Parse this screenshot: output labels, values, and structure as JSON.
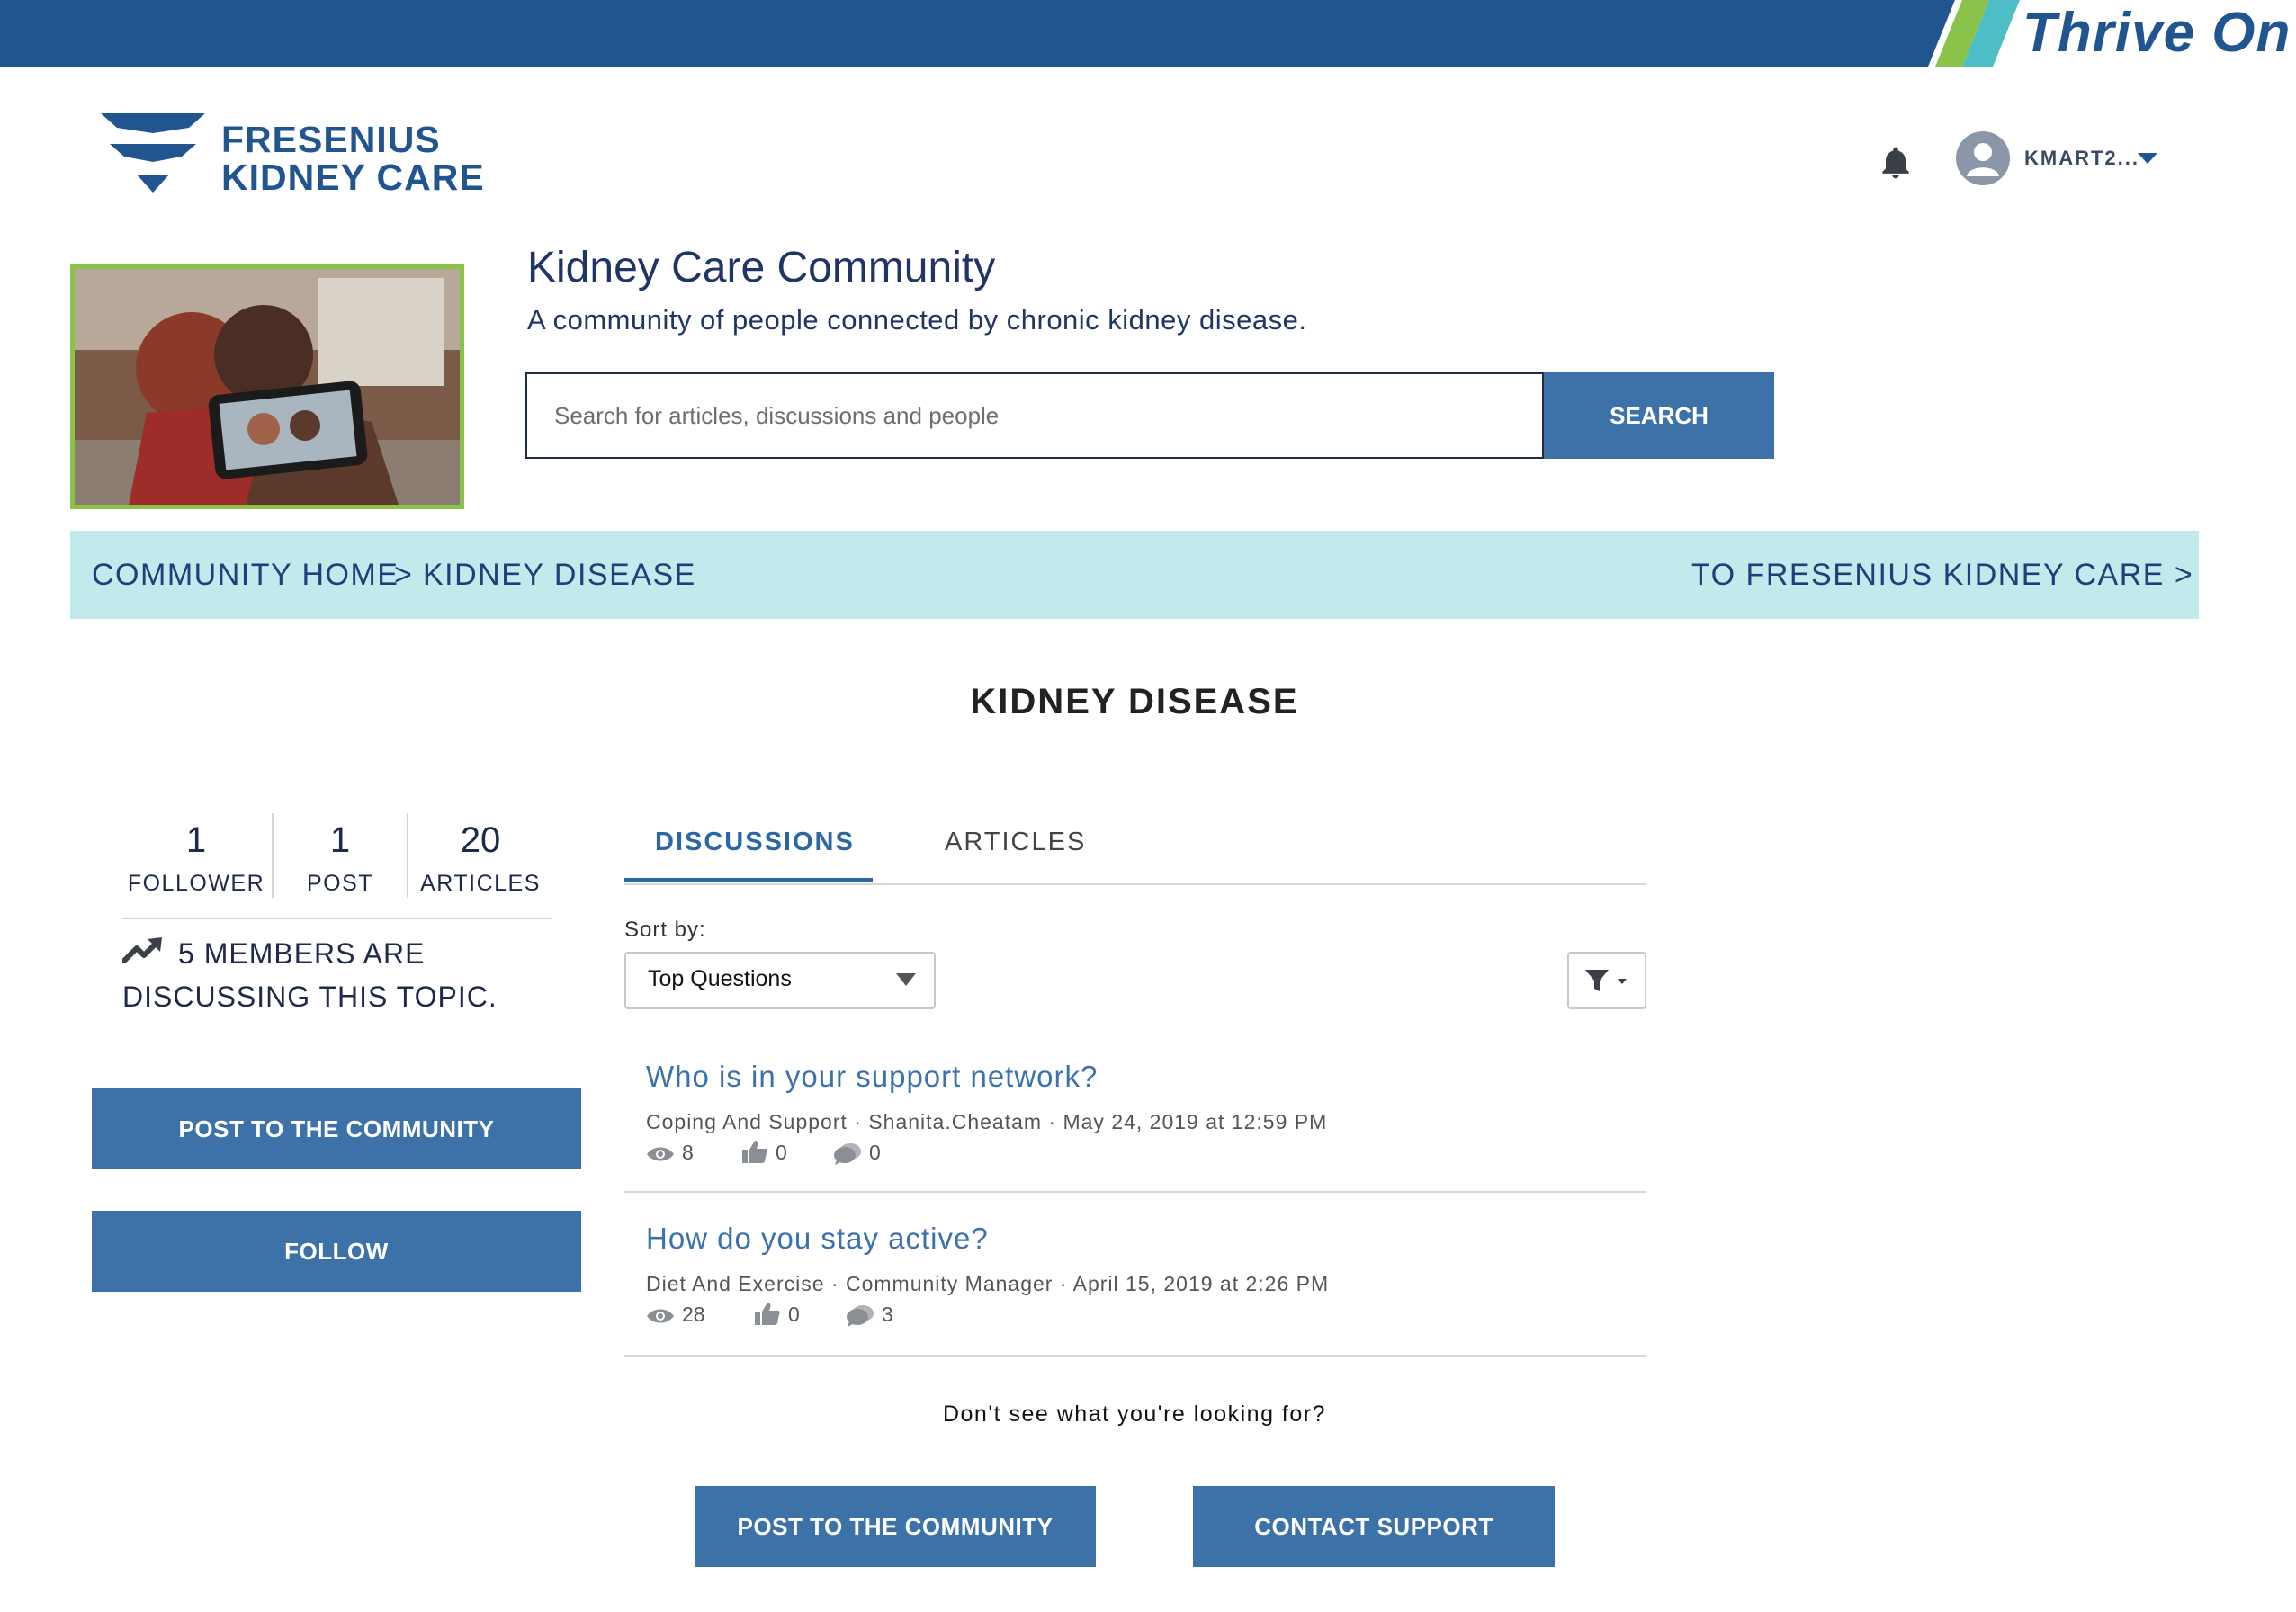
{
  "brand": {
    "tagline": "Thrive On",
    "name_line1": "FRESENIUS",
    "name_line2": "KIDNEY CARE"
  },
  "user": {
    "username": "KMART2..."
  },
  "hero": {
    "title": "Kidney Care Community",
    "subtitle": "A community of people connected by chronic kidney disease.",
    "search_placeholder": "Search for articles, discussions and people",
    "search_button": "SEARCH"
  },
  "breadcrumb": {
    "home": "COMMUNITY HOME",
    "separator": ">",
    "current": "KIDNEY DISEASE",
    "right_link": "TO FRESENIUS KIDNEY CARE >"
  },
  "topic": {
    "title": "KIDNEY DISEASE"
  },
  "stats": [
    {
      "value": "1",
      "label": "FOLLOWER"
    },
    {
      "value": "1",
      "label": "POST"
    },
    {
      "value": "20",
      "label": "ARTICLES"
    }
  ],
  "members_text": "5 MEMBERS ARE DISCUSSING THIS TOPIC.",
  "left_buttons": {
    "post": "POST TO THE COMMUNITY",
    "follow": "FOLLOW"
  },
  "tabs": [
    {
      "label": "DISCUSSIONS",
      "active": true
    },
    {
      "label": "ARTICLES",
      "active": false
    }
  ],
  "sort": {
    "label": "Sort by:",
    "value": "Top Questions"
  },
  "discussions": [
    {
      "title": "Who is in your support network?",
      "meta": "Coping And Support · Shanita.Cheatam · May 24, 2019 at 12:59 PM",
      "views": "8",
      "likes": "0",
      "replies": "0"
    },
    {
      "title": "How do you stay active?",
      "meta": "Diet And Exercise · Community Manager · April 15, 2019 at 2:26 PM",
      "views": "28",
      "likes": "0",
      "replies": "3"
    }
  ],
  "footer": {
    "help_text": "Don't see what you're looking for?",
    "post_button": "POST TO THE COMMUNITY",
    "contact_button": "CONTACT SUPPORT"
  },
  "colors": {
    "brand_blue": "#21558f",
    "button_blue": "#3c72a8",
    "band_teal": "#c2e9eb",
    "stripe_green": "#8bc34a",
    "stripe_teal": "#4dbdc6",
    "link_blue": "#3b72ad"
  }
}
